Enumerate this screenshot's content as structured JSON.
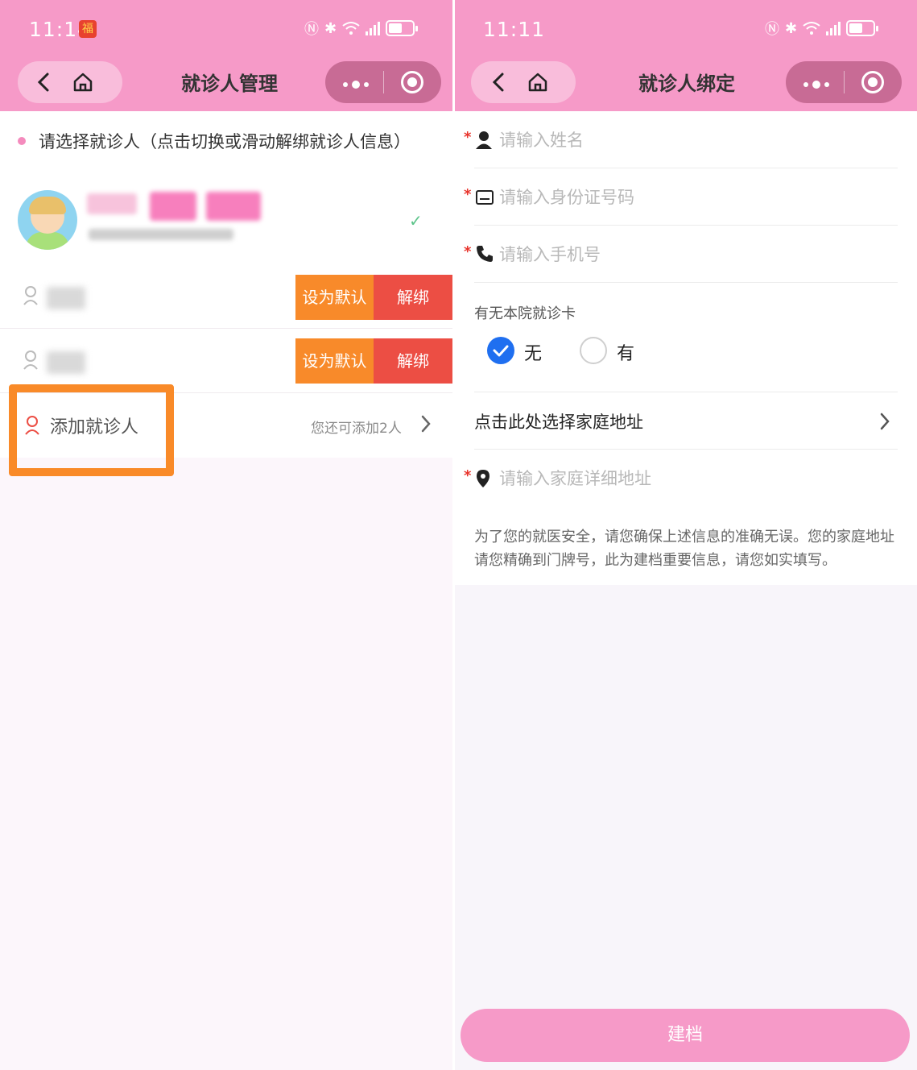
{
  "left": {
    "status": {
      "time": "11:14"
    },
    "nav": {
      "title": "就诊人管理"
    },
    "hint": "请选择就诊人（点击切换或滑动解绑就诊人信息）",
    "patients": [
      {
        "set_default": "设为默认",
        "unbind": "解绑"
      },
      {
        "set_default": "设为默认",
        "unbind": "解绑"
      }
    ],
    "add": {
      "label": "添加就诊人",
      "remaining": "您还可添加2人"
    }
  },
  "right": {
    "status": {
      "time": "11:11"
    },
    "nav": {
      "title": "就诊人绑定"
    },
    "fields": {
      "name_placeholder": "请输入姓名",
      "id_placeholder": "请输入身份证号码",
      "phone_placeholder": "请输入手机号",
      "address_placeholder": "请输入家庭详细地址"
    },
    "card": {
      "label": "有无本院就诊卡",
      "option_no": "无",
      "option_yes": "有",
      "selected": "无"
    },
    "address_select": "点击此处选择家庭地址",
    "notice": "为了您的就医安全，请您确保上述信息的准确无误。您的家庭地址请您精确到门牌号，此为建档重要信息，请您如实填写。",
    "submit": "建档"
  },
  "colors": {
    "header_pink": "#f69ac8",
    "set_default_orange": "#f88a2a",
    "unbind_red": "#ec4e44",
    "highlight_orange": "#f98a28",
    "radio_blue": "#1f6ff0",
    "required_red": "#e8332b"
  }
}
